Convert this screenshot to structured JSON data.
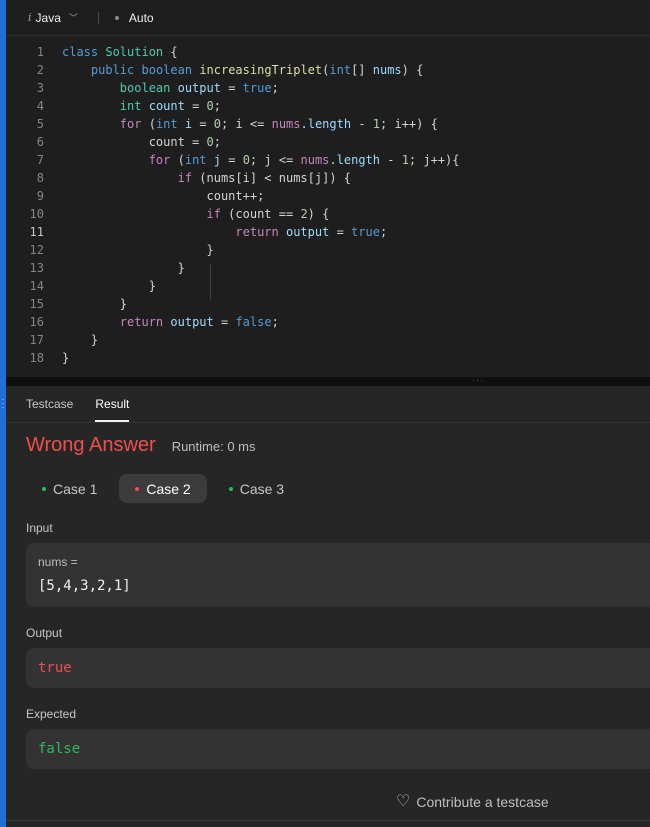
{
  "toolbar": {
    "language": "Java",
    "language_icon": "i",
    "mode": "Auto"
  },
  "editor": {
    "line_numbers": [
      "1",
      "2",
      "3",
      "4",
      "5",
      "6",
      "7",
      "8",
      "9",
      "10",
      "11",
      "12",
      "13",
      "14",
      "15",
      "16",
      "17",
      "18"
    ],
    "active_line": 11,
    "tokens": {
      "class_kw": "class",
      "class_name": "Solution",
      "public_kw": "public",
      "boolean_kw": "boolean",
      "method_name": "increasingTriplet",
      "int_kw": "int",
      "nums": "nums",
      "output": "output",
      "count": "count",
      "for_kw": "for",
      "if_kw": "if",
      "return_kw": "return",
      "true_kw": "true",
      "false_kw": "false",
      "i": "i",
      "j": "j",
      "zero": "0",
      "one": "1",
      "two": "2",
      "length": "length"
    }
  },
  "panel": {
    "tabs": [
      "Testcase",
      "Result"
    ],
    "active_tab": "Result",
    "verdict": "Wrong Answer",
    "runtime": "Runtime: 0 ms",
    "cases": [
      {
        "label": "Case 1",
        "status": "passed"
      },
      {
        "label": "Case 2",
        "status": "failed"
      },
      {
        "label": "Case 3",
        "status": "passed"
      }
    ],
    "active_case": "Case 2",
    "input_label": "Input",
    "input_var": "nums =",
    "input_value": "[5,4,3,2,1]",
    "output_label": "Output",
    "output_value": "true",
    "expected_label": "Expected",
    "expected_value": "false",
    "contribute": "Contribute a testcase"
  },
  "colors": {
    "accent": "#1e6fd9",
    "error": "#f04e4e",
    "success": "#2cbb5d"
  }
}
